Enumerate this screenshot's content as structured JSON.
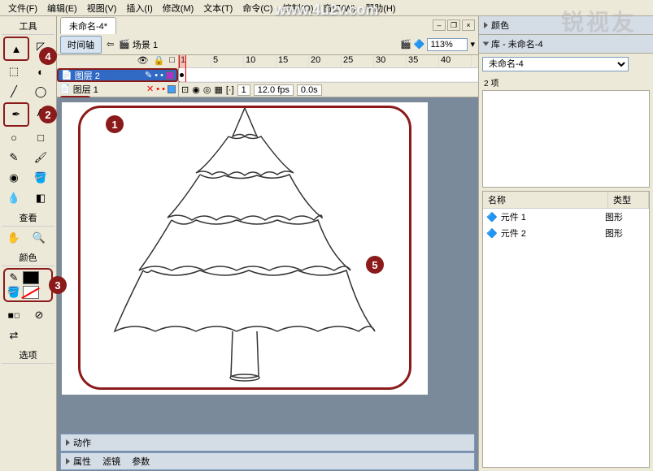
{
  "menu": {
    "file": "文件(F)",
    "edit": "编辑(E)",
    "view": "视图(V)",
    "insert": "插入(I)",
    "modify": "修改(M)",
    "text": "文本(T)",
    "commands": "命令(C)",
    "control": "控制(O)",
    "window": "窗口(W)",
    "help": "帮助(H)"
  },
  "watermark": "www.4u2v.com",
  "watermark2": "锐视友",
  "tools_title": "工具",
  "view_title": "查看",
  "color_title": "颜色",
  "options_title": "选项",
  "doc": {
    "title": "未命名-4*"
  },
  "toolbar": {
    "timeline": "时间轴",
    "scene": "场景 1",
    "zoom": "113%"
  },
  "layers": {
    "l2": "图层 2",
    "l1": "图层 1"
  },
  "timeline_ruler": [
    "1",
    "5",
    "10",
    "15",
    "20",
    "25",
    "30",
    "35",
    "40"
  ],
  "frame_status": {
    "frame": "1",
    "fps": "12.0 fps",
    "time": "0.0s"
  },
  "bottom": {
    "actions": "动作",
    "props": "属性",
    "filters": "滤镜",
    "params": "参数"
  },
  "right": {
    "color": "颜色",
    "library": "库 - 未命名-4",
    "lib_doc": "未命名-4",
    "count": "2 项",
    "col_name": "名称",
    "col_type": "类型",
    "items": [
      {
        "name": "元件 1",
        "type": "图形"
      },
      {
        "name": "元件 2",
        "type": "图形"
      }
    ]
  },
  "callouts": {
    "c1": "1",
    "c2": "2",
    "c3": "3",
    "c4": "4",
    "c5": "5"
  }
}
